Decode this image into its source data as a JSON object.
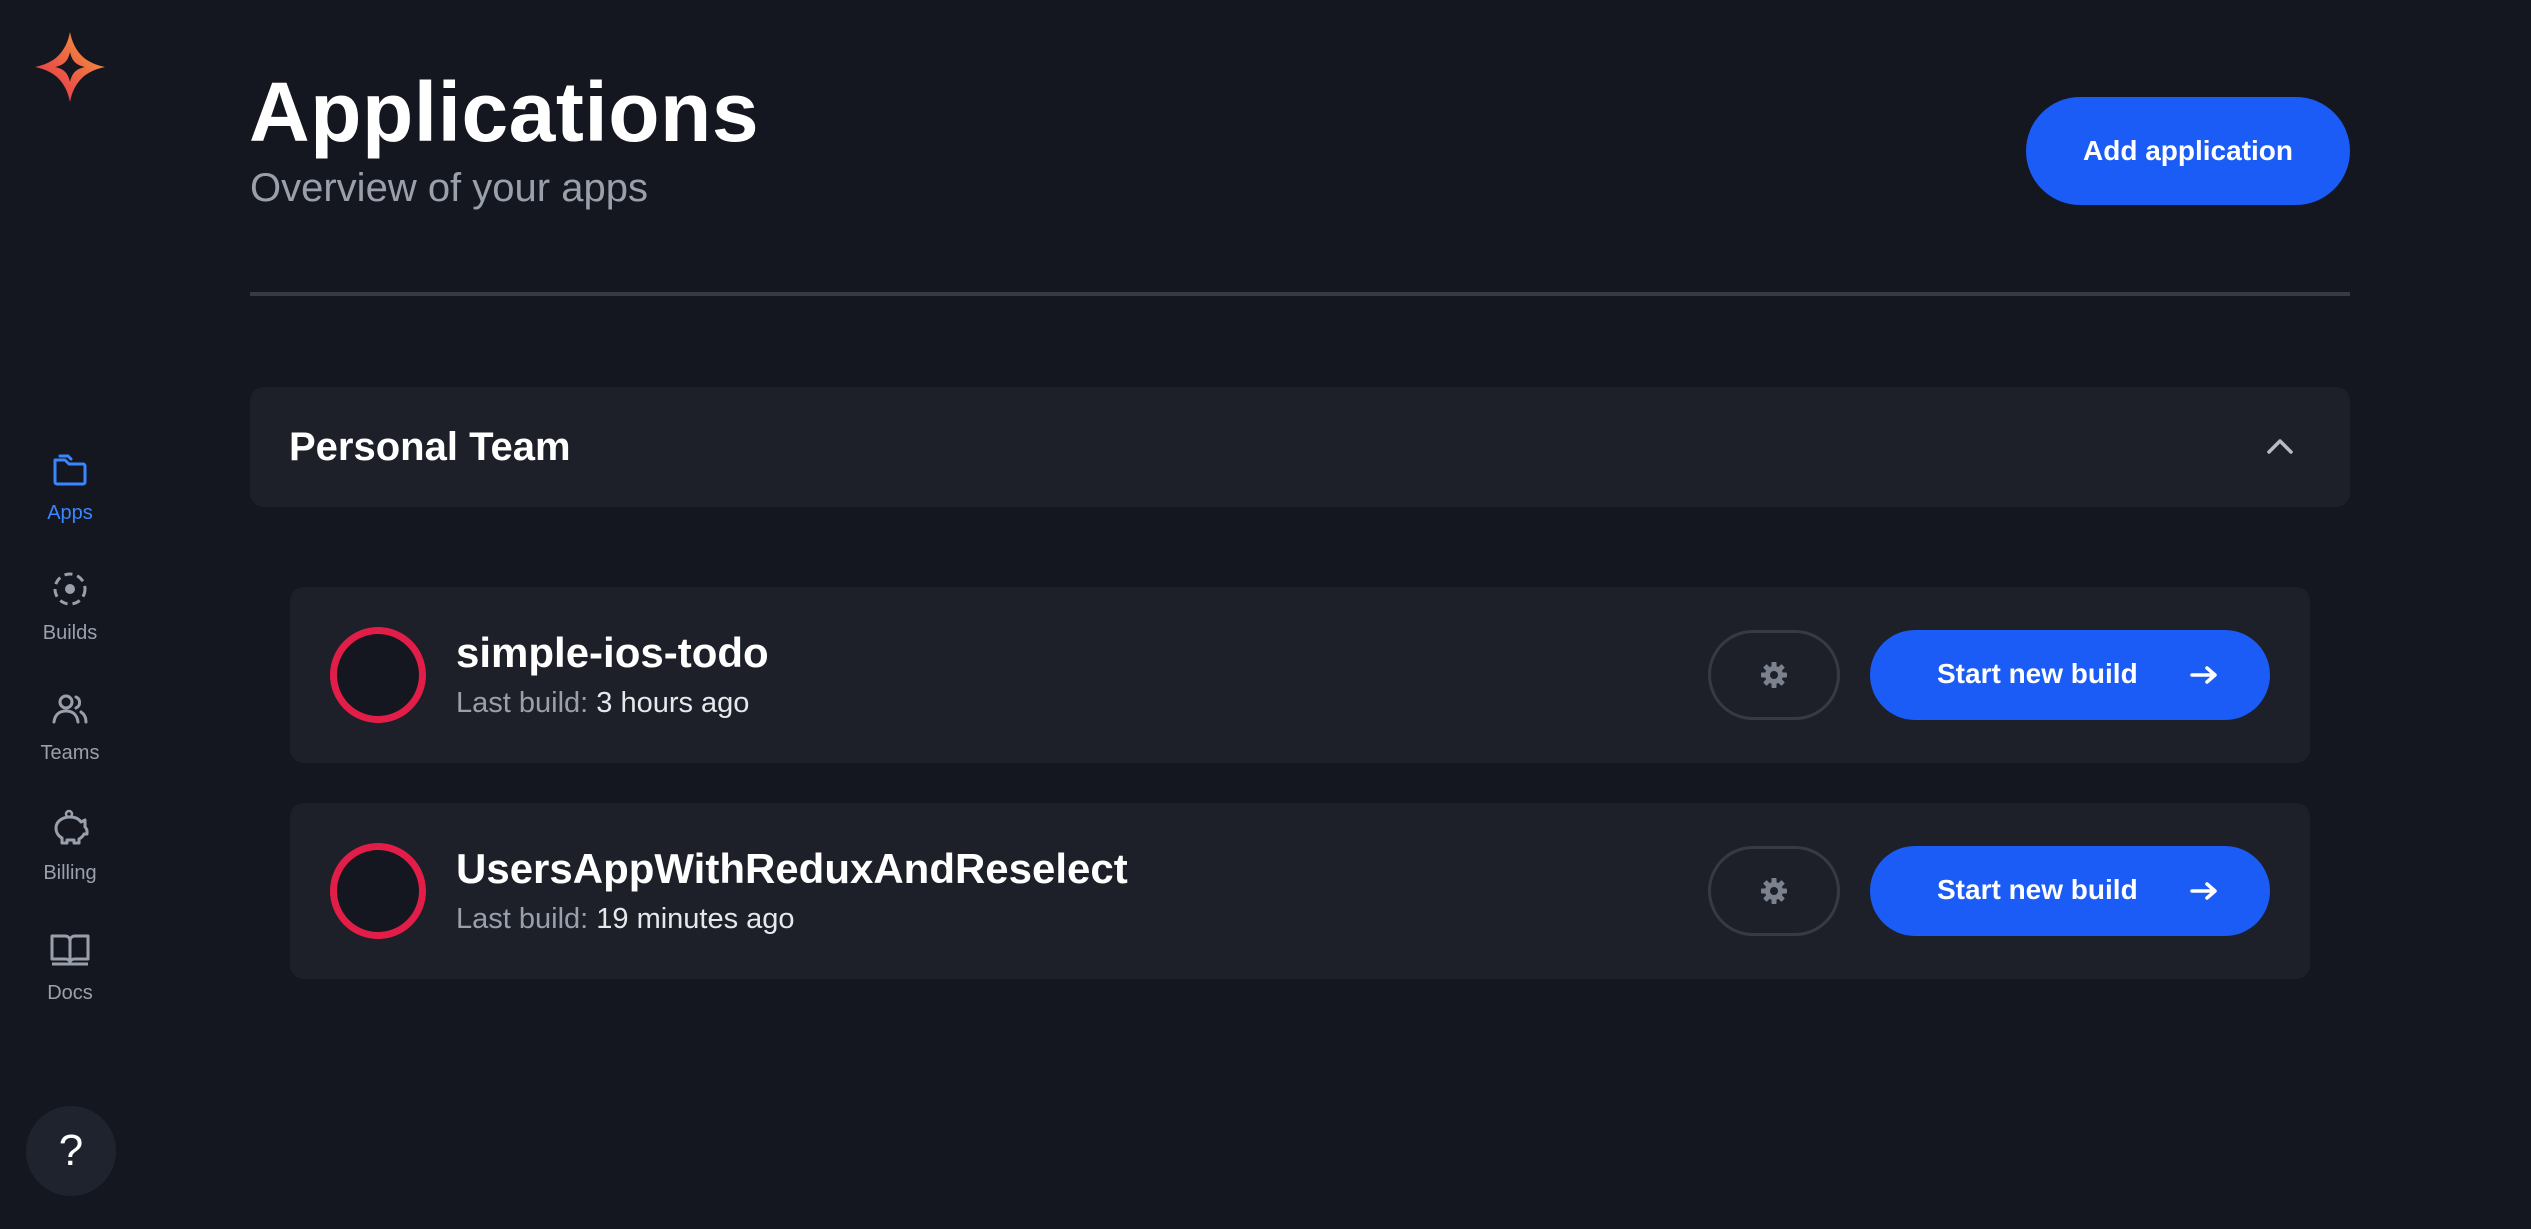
{
  "sidebar": {
    "logo_icon": "sparkle-logo-icon",
    "items": [
      {
        "label": "Apps",
        "icon": "folders-icon",
        "active": true
      },
      {
        "label": "Builds",
        "icon": "builds-cycle-icon",
        "active": false
      },
      {
        "label": "Teams",
        "icon": "users-icon",
        "active": false
      },
      {
        "label": "Billing",
        "icon": "piggy-bank-icon",
        "active": false
      },
      {
        "label": "Docs",
        "icon": "book-icon",
        "active": false
      }
    ],
    "help_label": "?"
  },
  "header": {
    "title": "Applications",
    "subtitle": "Overview of your apps",
    "add_button_label": "Add application"
  },
  "team": {
    "name": "Personal Team",
    "expanded": true,
    "apps": [
      {
        "name": "simple-ios-todo",
        "last_build_label": "Last build:",
        "last_build_value": "3 hours ago",
        "build_button_label": "Start new build"
      },
      {
        "name": "UsersAppWithReduxAndReselect",
        "last_build_label": "Last build:",
        "last_build_value": "19 minutes ago",
        "build_button_label": "Start new build"
      }
    ]
  },
  "colors": {
    "background": "#141720",
    "panel": "#1d2029",
    "accent": "#1a5cf5",
    "active_nav": "#3a86ff",
    "status_failed": "#e11d48",
    "muted_text": "#9aa0ab"
  }
}
